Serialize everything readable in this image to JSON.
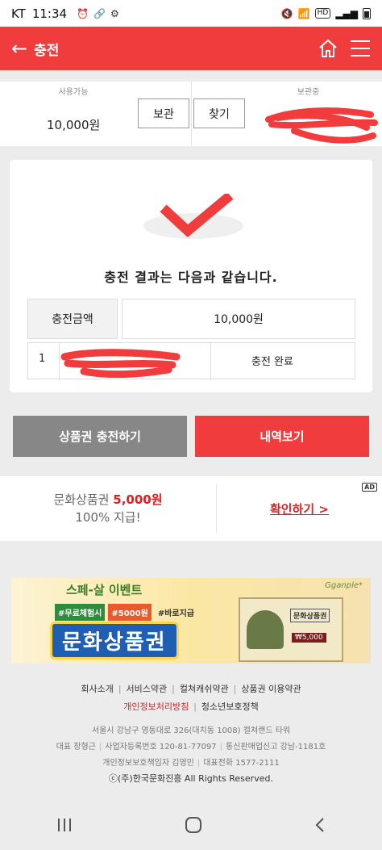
{
  "status_bar": {
    "carrier": "KT",
    "time": "11:34",
    "icons": [
      "alarm-icon",
      "link-icon",
      "settings-icon"
    ],
    "right_icons": [
      "mute-icon",
      "wifi-icon",
      "signal-icon",
      "battery-icon"
    ],
    "hd_label": "HD"
  },
  "app_bar": {
    "title": "충전",
    "back_icon": "arrow-left-icon",
    "home_icon": "home-icon",
    "menu_icon": "hamburger-icon"
  },
  "balance": {
    "available_label": "사용가능",
    "available_value": "10,000원",
    "keep_button": "보관",
    "find_button": "찾기",
    "stored_label": "보관중"
  },
  "result": {
    "message": "충전 결과는 다음과 같습니다.",
    "amount_label": "충전금액",
    "amount_value": "10,000원",
    "row_number": "1",
    "row_status": "충전 완료"
  },
  "actions": {
    "charge_button": "상품권 충전하기",
    "history_button": "내역보기"
  },
  "ad": {
    "text_prefix": "문화상품권 ",
    "text_highlight": "5,000원",
    "text_line2": "100% 지급!",
    "link": "확인하기 >",
    "badge": "AD"
  },
  "promo": {
    "event": "스페-살 이벤트",
    "tag1": "#무료체험시",
    "tag2": "#5000원",
    "tag3": "#바로지급",
    "title": "문화상품권",
    "brand": "Gganple*",
    "ticket_title": "문화상품권",
    "ticket_price": "₩5,000"
  },
  "footer": {
    "links_row1": [
      "회사소개",
      "서비스약관",
      "컬쳐캐쉬약관",
      "상품권 이용약관"
    ],
    "privacy": "개인정보처리방침",
    "youth": "청소년보호정책",
    "address": "서울시 강남구 영동대로 326(대치동 1008) 컬쳐랜드 타워",
    "ceo": "대표 장형근",
    "biz_no": "사업자등록번호 120-81-77097",
    "mail_order": "통신판매업신고 강남-1181호",
    "privacy_officer": "개인정보보호책임자 김영민",
    "phone": "대표전화 1577-2111",
    "copyright": "ⓒ(주)한국문화진흥 All Rights Reserved."
  },
  "nav_bar": {
    "icons": [
      "recent-apps-icon",
      "home-button-icon",
      "back-button-icon"
    ]
  },
  "colors": {
    "brand_red": "#f03c3c",
    "gray_button": "#878787",
    "background": "#ececec"
  }
}
